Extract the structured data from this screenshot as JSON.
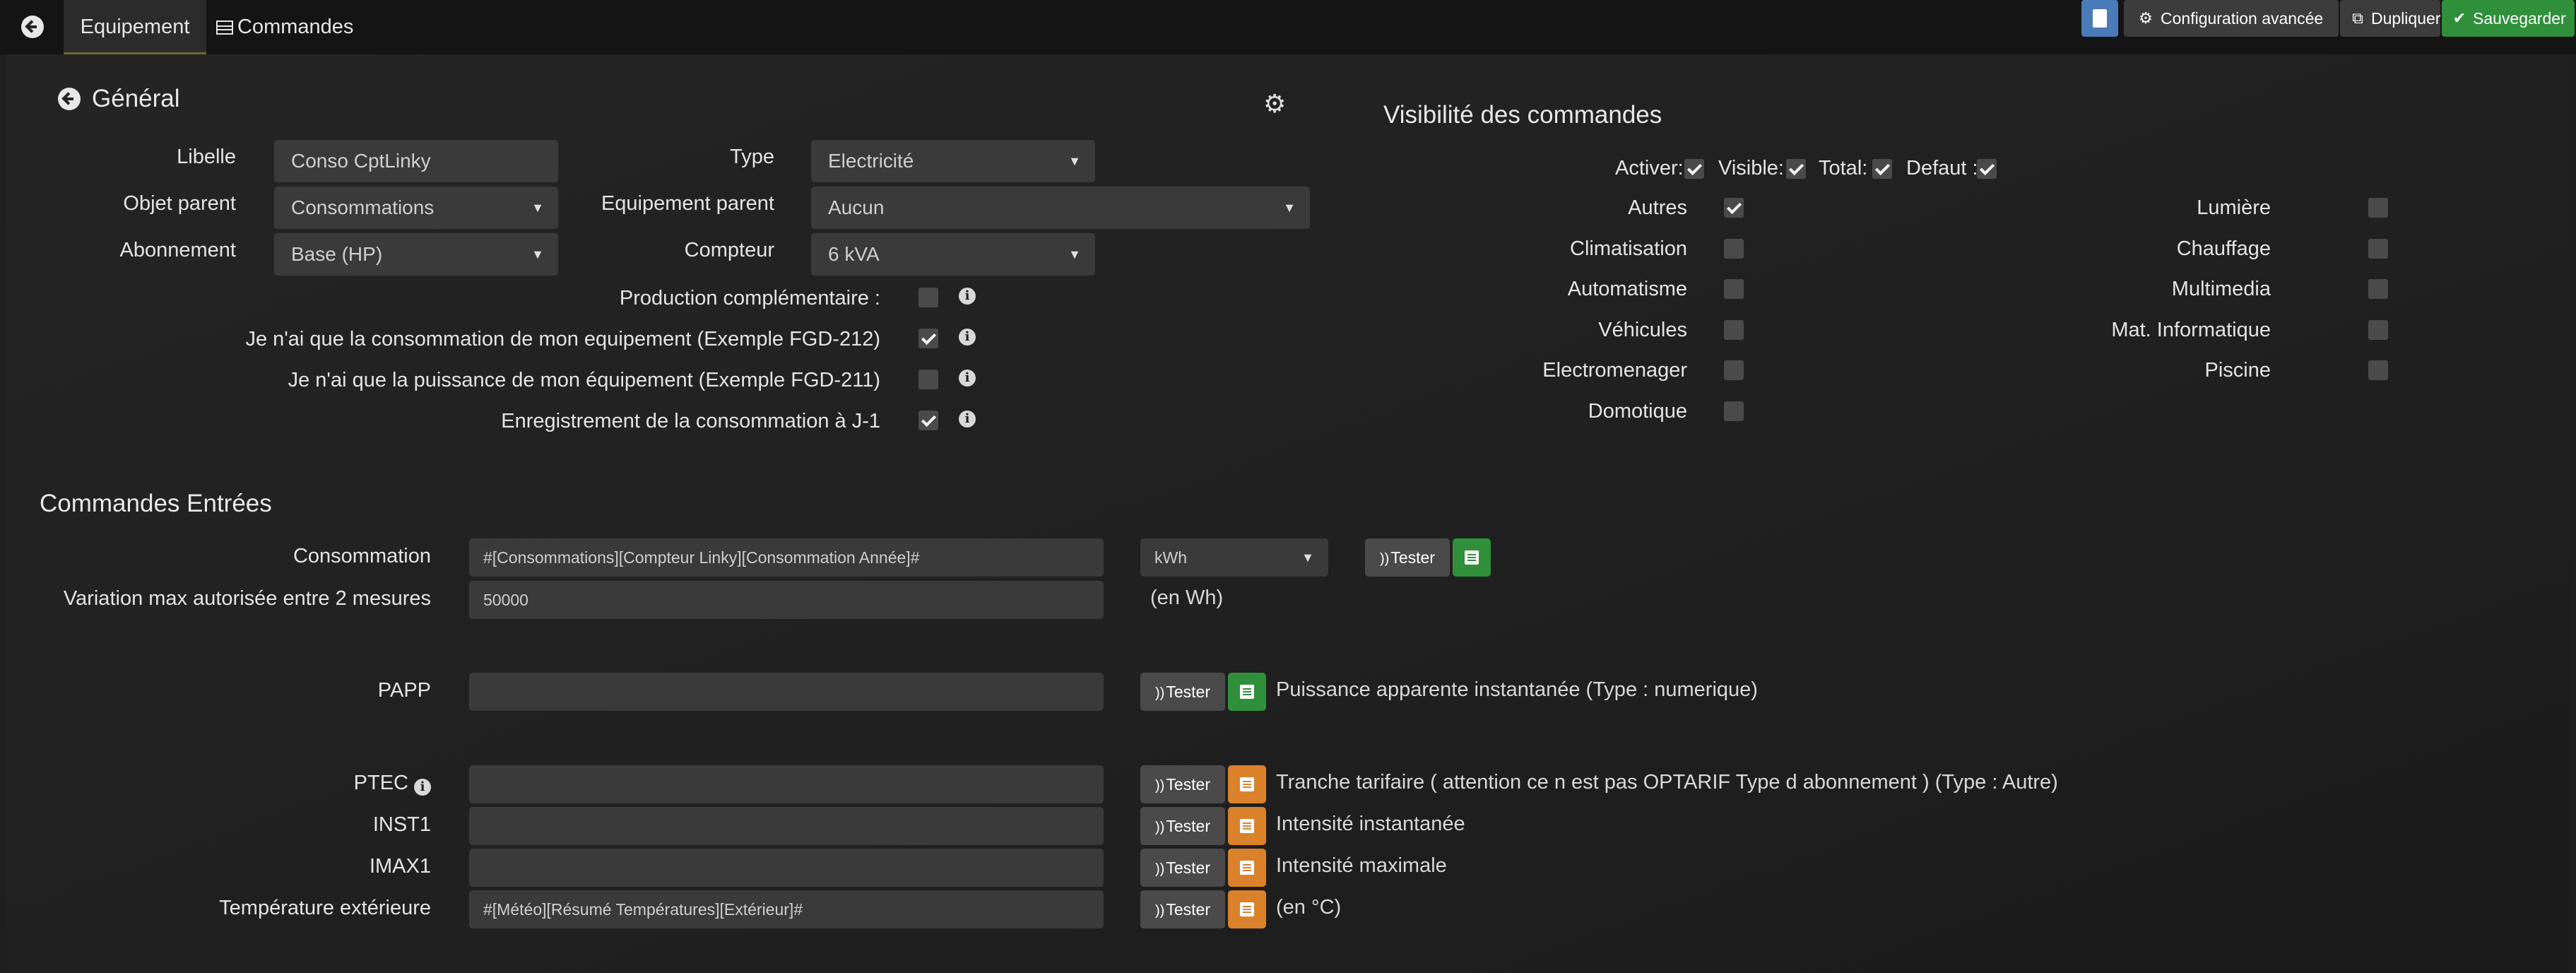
{
  "tabs": {
    "equipement": "Equipement",
    "commandes": "Commandes"
  },
  "toolbar": {
    "config": "Configuration avancée",
    "duplicate": "Dupliquer",
    "save": "Sauvegarder",
    "colors": {
      "blue": "#4a7ab8",
      "dark": "#3c3c3c",
      "green": "#2f8f3b"
    }
  },
  "general": {
    "title": "Général",
    "libelle_label": "Libelle",
    "libelle_value": "Conso CptLinky",
    "objet_label": "Objet parent",
    "objet_value": "Consommations",
    "abonnement_label": "Abonnement",
    "abonnement_value": "Base (HP)",
    "type_label": "Type",
    "type_value": "Electricité",
    "equip_parent_label": "Equipement parent",
    "equip_parent_value": "Aucun",
    "compteur_label": "Compteur",
    "compteur_value": "6 kVA",
    "options": [
      {
        "label": "Production complémentaire :",
        "checked": false
      },
      {
        "label": "Je n'ai que la consommation de mon equipement (Exemple FGD-212)",
        "checked": true
      },
      {
        "label": "Je n'ai que la puissance de mon équipement (Exemple FGD-211)",
        "checked": false
      },
      {
        "label": "Enregistrement de la consommation à J-1",
        "checked": true
      }
    ]
  },
  "visibility": {
    "title": "Visibilité des commandes",
    "activer": "Activer:",
    "visible": "Visible:",
    "total": "Total:",
    "defaut": "Defaut :",
    "left": [
      {
        "label": "Autres",
        "checked": true
      },
      {
        "label": "Climatisation",
        "checked": false
      },
      {
        "label": "Automatisme",
        "checked": false
      },
      {
        "label": "Véhicules",
        "checked": false
      },
      {
        "label": "Electromenager",
        "checked": false
      },
      {
        "label": "Domotique",
        "checked": false
      }
    ],
    "right": [
      {
        "label": "Lumière",
        "checked": false
      },
      {
        "label": "Chauffage",
        "checked": false
      },
      {
        "label": "Multimedia",
        "checked": false
      },
      {
        "label": "Mat. Informatique",
        "checked": false
      },
      {
        "label": "Piscine",
        "checked": false
      }
    ]
  },
  "entrees": {
    "title": "Commandes Entrées",
    "tester": "Tester",
    "consommation_label": "Consommation",
    "consommation_value": "#[Consommations][Compteur Linky][Consommation Année]#",
    "unit_value": "kWh",
    "variation_label": "Variation max autorisée entre 2 mesures",
    "variation_value": "50000",
    "variation_unit": "(en Wh)",
    "papp_label": "PAPP",
    "papp_desc": "Puissance apparente instantanée (Type : numerique)",
    "ptec_label": "PTEC",
    "ptec_desc": "Tranche tarifaire ( attention ce n est pas OPTARIF Type d abonnement ) (Type : Autre)",
    "inst1_label": "INST1",
    "inst1_desc": "Intensité instantanée",
    "imax1_label": "IMAX1",
    "imax1_desc": "Intensité maximale",
    "temp_label": "Température extérieure",
    "temp_value": "#[Météo][Résumé Températures][Extérieur]#",
    "temp_unit": "(en °C)"
  }
}
